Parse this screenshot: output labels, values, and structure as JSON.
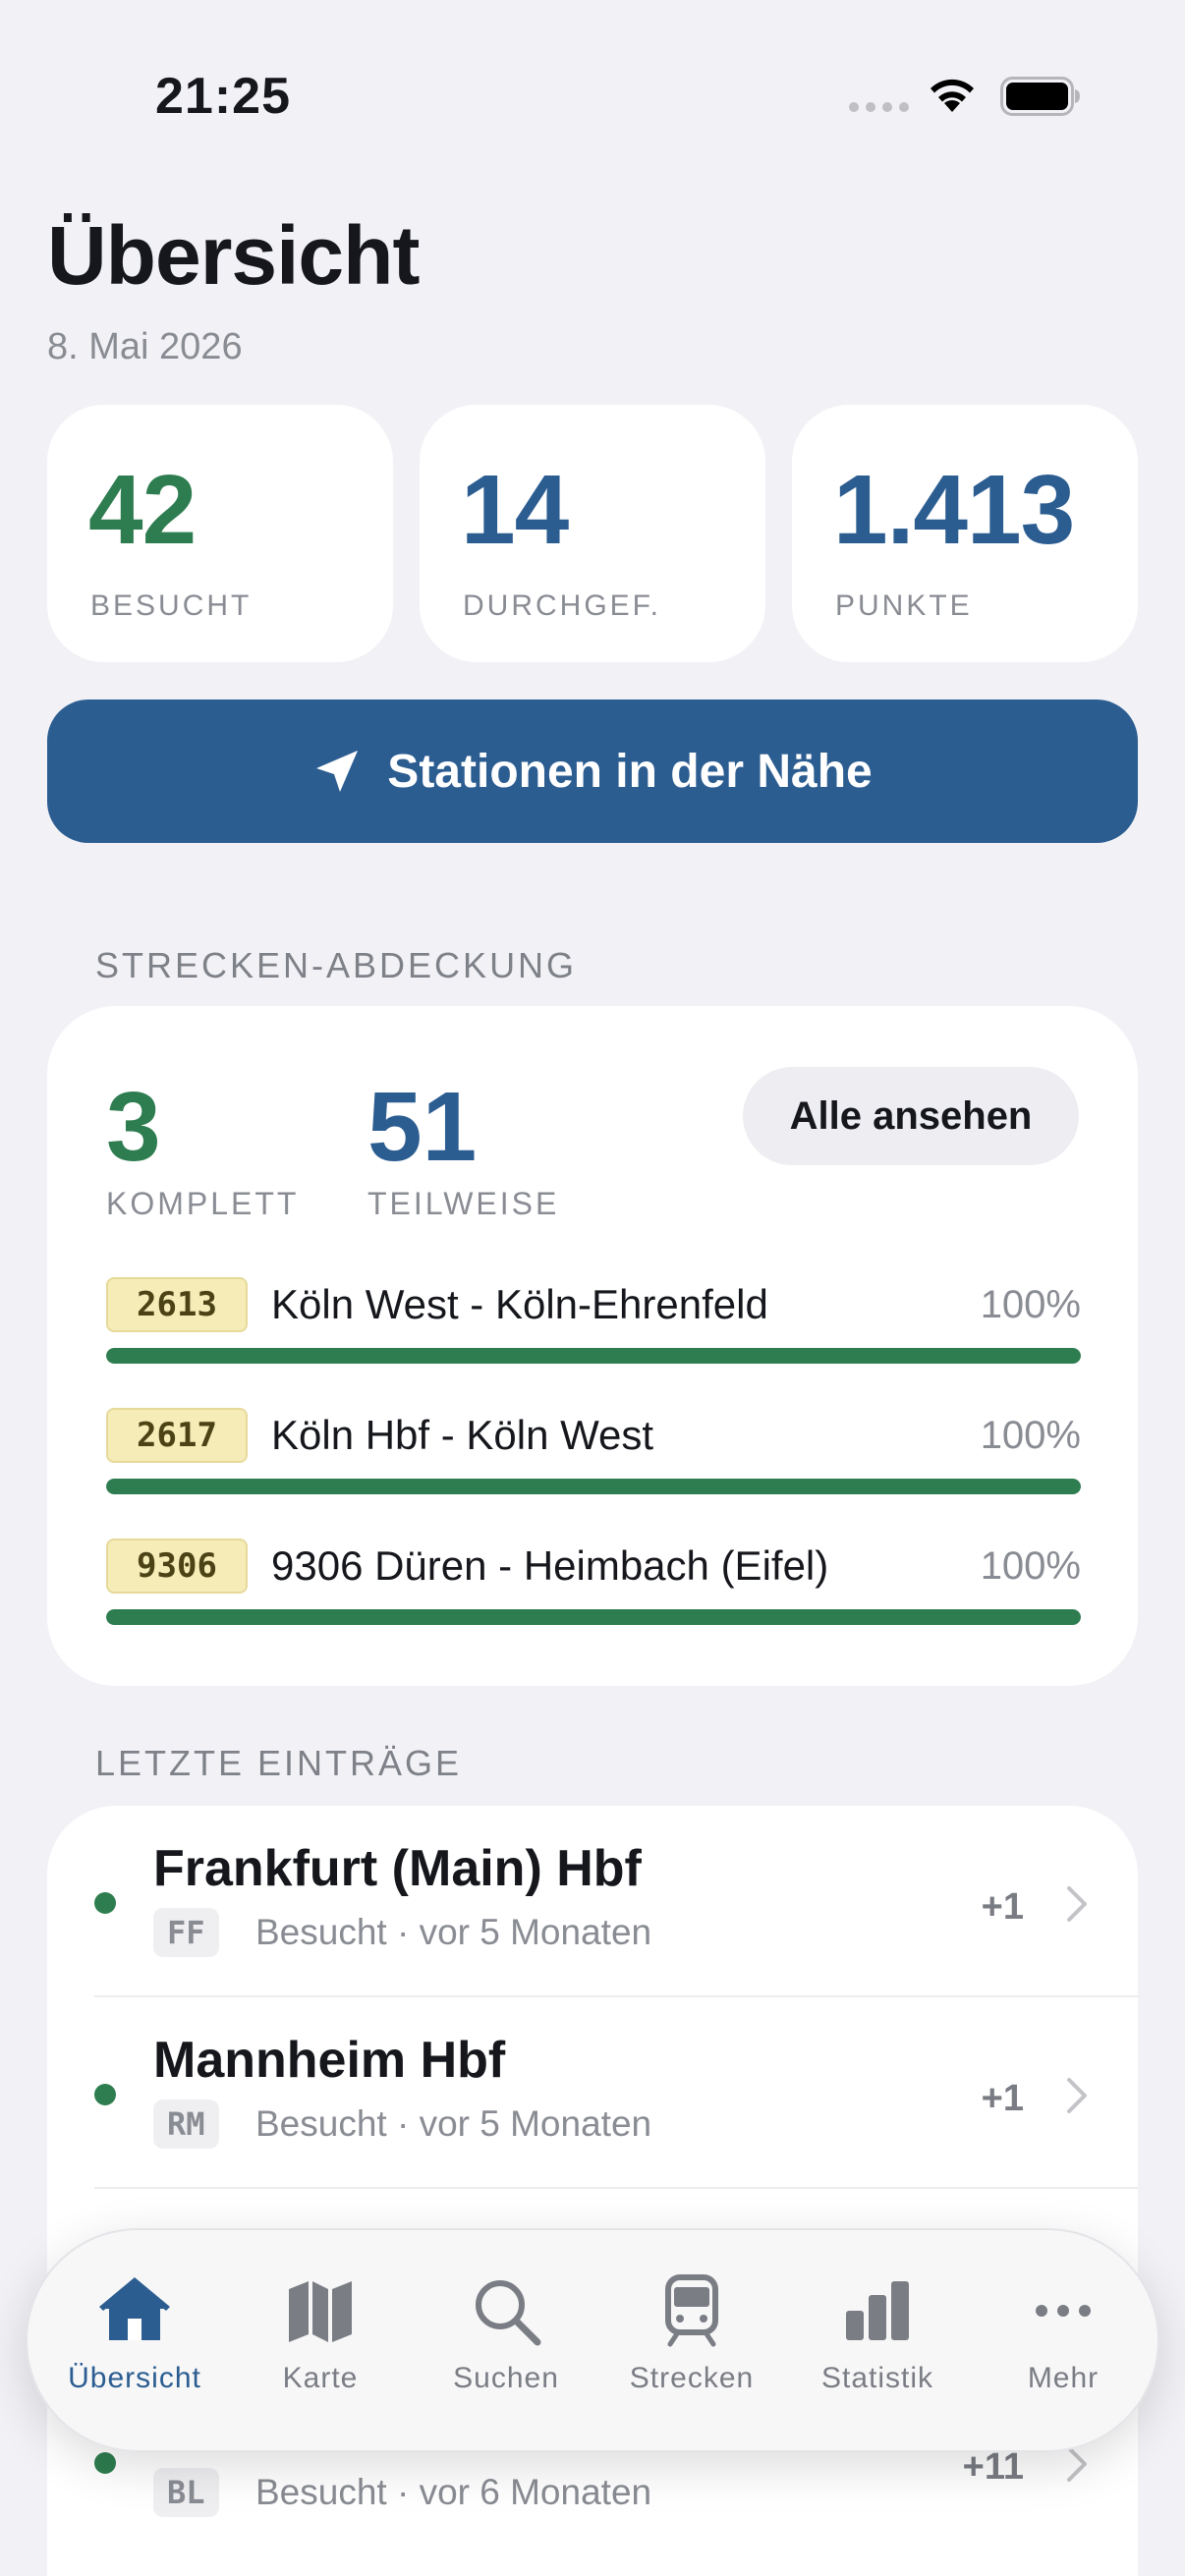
{
  "status_bar": {
    "time": "21:25"
  },
  "header": {
    "title": "Übersicht",
    "date": "8. Mai 2026"
  },
  "stats": [
    {
      "value": "42",
      "label": "BESUCHT",
      "color": "#2e7d50"
    },
    {
      "value": "14",
      "label": "DURCHGEF.",
      "color": "#2c5d91"
    },
    {
      "value": "1.413",
      "label": "PUNKTE",
      "color": "#2c5d91"
    }
  ],
  "nearby_button": {
    "label": "Stationen in der Nähe",
    "icon": "location-arrow-icon"
  },
  "coverage": {
    "section_title": "STRECKEN-ABDECKUNG",
    "complete_value": "3",
    "complete_label": "KOMPLETT",
    "partial_value": "51",
    "partial_label": "TEILWEISE",
    "all_button": "Alle ansehen",
    "routes": [
      {
        "number": "2613",
        "name": "Köln West - Köln-Ehrenfeld",
        "percent": "100%",
        "progress": 1.0
      },
      {
        "number": "2617",
        "name": "Köln Hbf - Köln West",
        "percent": "100%",
        "progress": 1.0
      },
      {
        "number": "9306",
        "name": "9306 Düren - Heimbach (Eifel)",
        "percent": "100%",
        "progress": 1.0
      }
    ]
  },
  "recent": {
    "section_title": "LETZTE EINTRÄGE",
    "entries": [
      {
        "title": "Frankfurt (Main) Hbf",
        "code": "FF",
        "subtitle": "Besucht · vor 5 Monaten",
        "count": "+1"
      },
      {
        "title": "Mannheim Hbf",
        "code": "RM",
        "subtitle": "Besucht · vor 5 Monaten",
        "count": "+1"
      },
      {
        "title": "",
        "code": "",
        "subtitle": "",
        "count": ""
      },
      {
        "title": "",
        "code": "BL",
        "subtitle": "Besucht · vor 6 Monaten",
        "count": "+11"
      }
    ]
  },
  "tab_bar": {
    "tabs": [
      {
        "label": "Übersicht",
        "icon": "house-icon",
        "active": true
      },
      {
        "label": "Karte",
        "icon": "map-icon",
        "active": false
      },
      {
        "label": "Suchen",
        "icon": "search-icon",
        "active": false
      },
      {
        "label": "Strecken",
        "icon": "train-icon",
        "active": false
      },
      {
        "label": "Statistik",
        "icon": "bar-chart-icon",
        "active": false
      },
      {
        "label": "Mehr",
        "icon": "ellipsis-icon",
        "active": false
      }
    ]
  },
  "colors": {
    "accent_blue": "#2c5d91",
    "accent_green": "#2e7d50",
    "background": "#f2f2f6"
  }
}
